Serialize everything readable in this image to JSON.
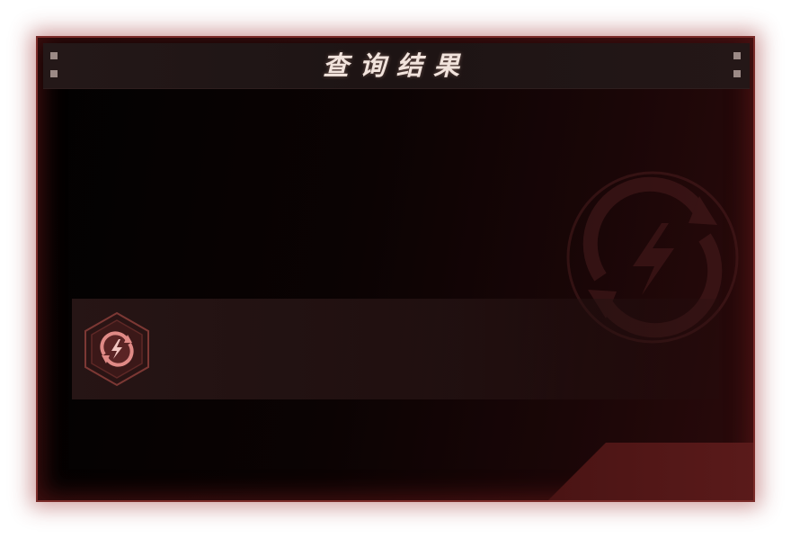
{
  "dialog": {
    "title": "查询结果"
  },
  "result": {
    "icon": "energy-refresh-icon"
  },
  "watermark": {
    "icon": "energy-refresh-icon"
  },
  "colors": {
    "frame_border": "#7a2a28",
    "glow": "#962828",
    "title_text": "#f1e3dc",
    "icon_accent": "#e08a86",
    "badge_fill": "#2a1414"
  }
}
